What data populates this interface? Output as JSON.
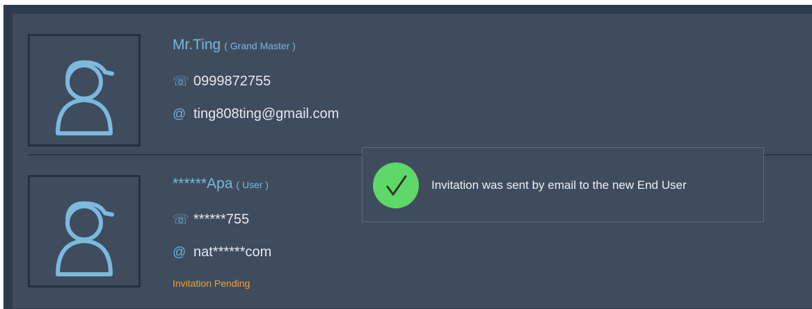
{
  "contacts": [
    {
      "name": "Mr.Ting",
      "role": "( Grand Master )",
      "phone": "0999872755",
      "email": "ting808ting@gmail.com",
      "status": ""
    },
    {
      "name": "******Apa",
      "role": "( User )",
      "phone": "******755",
      "email": "nat******com",
      "status": "Invitation Pending"
    }
  ],
  "icons": {
    "avatar": "user-avatar-icon",
    "phone": "phone-icon",
    "email": "at-sign-icon",
    "success": "check-circle-icon"
  },
  "toast": {
    "message": "Invitation was sent by email to the new End User"
  },
  "colors": {
    "name": "#79b8dc",
    "pending": "#f0a030",
    "success": "#5fd86a"
  }
}
